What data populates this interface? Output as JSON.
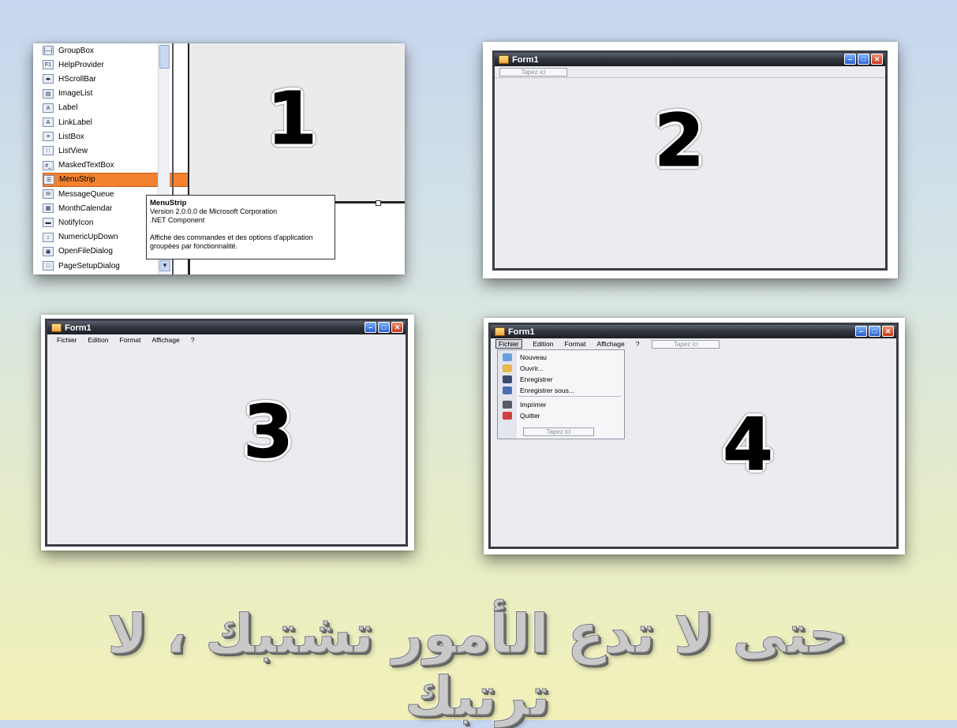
{
  "panel1": {
    "toolbox_items": [
      {
        "label": "GroupBox",
        "icon": "groupbox-icon",
        "glyph": "[—]"
      },
      {
        "label": "HelpProvider",
        "icon": "helpprovider-icon",
        "glyph": "F1"
      },
      {
        "label": "HScrollBar",
        "icon": "hscrollbar-icon",
        "glyph": "◂▸"
      },
      {
        "label": "ImageList",
        "icon": "imagelist-icon",
        "glyph": "▤"
      },
      {
        "label": "Label",
        "icon": "label-icon",
        "glyph": "A"
      },
      {
        "label": "LinkLabel",
        "icon": "linklabel-icon",
        "glyph": "A"
      },
      {
        "label": "ListBox",
        "icon": "listbox-icon",
        "glyph": "≡"
      },
      {
        "label": "ListView",
        "icon": "listview-icon",
        "glyph": "∷"
      },
      {
        "label": "MaskedTextBox",
        "icon": "maskedtextbox-icon",
        "glyph": "#_"
      },
      {
        "label": "MenuStrip",
        "icon": "menustrip-icon",
        "glyph": "☰"
      },
      {
        "label": "MessageQueue",
        "icon": "messagequeue-icon",
        "glyph": "✉"
      },
      {
        "label": "MonthCalendar",
        "icon": "monthcalendar-icon",
        "glyph": "▦"
      },
      {
        "label": "NotifyIcon",
        "icon": "notifyicon-icon",
        "glyph": "▬"
      },
      {
        "label": "NumericUpDown",
        "icon": "numericupdown-icon",
        "glyph": "↕"
      },
      {
        "label": "OpenFileDialog",
        "icon": "openfiledialog-icon",
        "glyph": "▣"
      },
      {
        "label": "PageSetupDialog",
        "icon": "pagesetupdialog-icon",
        "glyph": "□"
      }
    ],
    "selected_item": "MenuStrip",
    "tooltip": {
      "title": "MenuStrip",
      "line1": "Version 2.0.0.0 de Microsoft Corporation",
      "line2": ".NET Component",
      "line3": "Affiche des commandes et des options d'application",
      "line4": "groupées par fonctionnalité."
    },
    "step": "1"
  },
  "panel2": {
    "form_title": "Form1",
    "tapez": "Tapez ici",
    "step": "2"
  },
  "panel3": {
    "form_title": "Form1",
    "menus": [
      "Fichier",
      "Edition",
      "Format",
      "Affichage",
      "?"
    ],
    "step": "3"
  },
  "panel4": {
    "form_title": "Form1",
    "menus": [
      "Fichier",
      "Edition",
      "Format",
      "Affichage",
      "?"
    ],
    "menubar_tapez": "Tapez ici",
    "dropdown": [
      {
        "label": "Nouveau",
        "icon": "new-icon",
        "color": "#6aa0e0"
      },
      {
        "label": "Ouvrir...",
        "icon": "open-folder-icon",
        "color": "#e8b84a"
      },
      {
        "label": "Enregistrer",
        "icon": "save-icon",
        "color": "#3a4a70"
      },
      {
        "label": "Enregistrer sous...",
        "icon": "save-as-icon",
        "color": "#4a6fb0"
      },
      {
        "label": "Imprimer",
        "icon": "printer-icon",
        "color": "#555a66"
      },
      {
        "label": "Quitter",
        "icon": "quit-icon",
        "color": "#d04040"
      }
    ],
    "dropdown_tapez": "Tapez ici",
    "step": "4"
  },
  "footer_text": "حتى لا تدع الأمور تشتبك ، لا ترتبك"
}
